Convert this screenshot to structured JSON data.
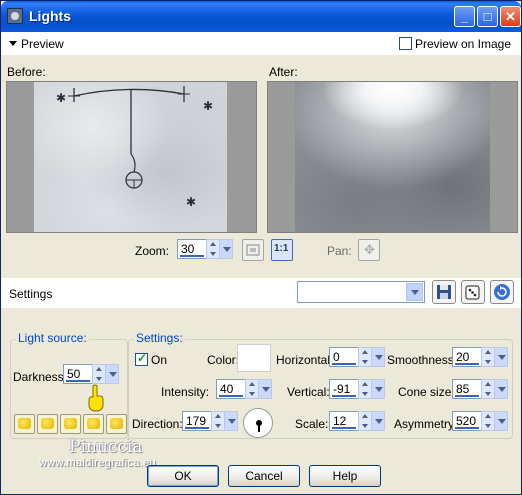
{
  "window": {
    "title": "Lights"
  },
  "titlebar": {
    "minimize": "_",
    "maximize": "□",
    "close": "✕"
  },
  "preview_bar": {
    "toggle_label": "Preview",
    "preview_on_image_label": "Preview on Image",
    "preview_on_image_checked": false
  },
  "panes": {
    "before_label": "Before:",
    "after_label": "After:"
  },
  "zoom": {
    "label": "Zoom:",
    "value": "30",
    "pan_label": "Pan:",
    "one_to_one": "1:1"
  },
  "settings_bar": {
    "label": "Settings",
    "preset_value": ""
  },
  "light_source": {
    "title": "Light source:",
    "darkness_label": "Darkness:",
    "darkness_value": "50",
    "presets": [
      "1",
      "2",
      "3",
      "4",
      "5"
    ]
  },
  "settings": {
    "title": "Settings:",
    "on_label": "On",
    "on_checked": true,
    "color_label": "Color:",
    "color_value": "#ffffff",
    "horizontal_label": "Horizontal:",
    "horizontal_value": "0",
    "smoothness_label": "Smoothness:",
    "smoothness_value": "20",
    "intensity_label": "Intensity:",
    "intensity_value": "40",
    "vertical_label": "Vertical:",
    "vertical_value": "-91",
    "cone_size_label": "Cone size:",
    "cone_size_value": "85",
    "direction_label": "Direction:",
    "direction_value": "179",
    "scale_label": "Scale:",
    "scale_value": "12",
    "asymmetry_label": "Asymmetry:",
    "asymmetry_value": "520"
  },
  "buttons": {
    "ok": "OK",
    "cancel": "Cancel",
    "help": "Help"
  },
  "watermark": {
    "name": "Pinuccia",
    "url": "www.maidiregrafica.eu"
  }
}
